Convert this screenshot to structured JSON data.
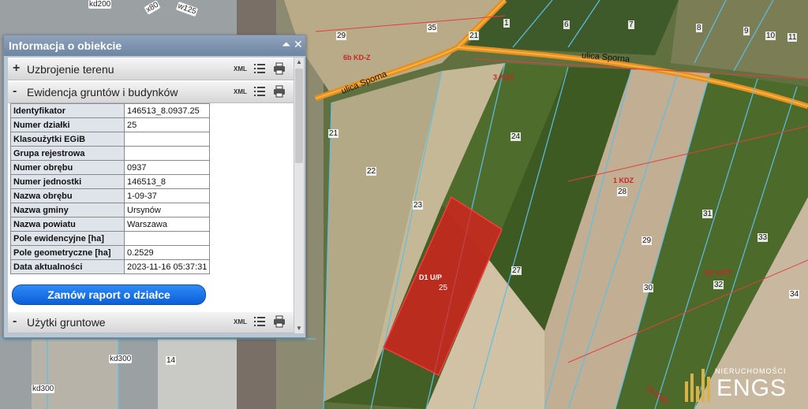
{
  "panel": {
    "title": "Informacja o obiekcie",
    "minimize_symbol": "⏶",
    "close_symbol": "✕",
    "sections": [
      {
        "sign": "+",
        "label": "Uzbrojenie terenu",
        "xml": "XML"
      },
      {
        "sign": "-",
        "label": "Ewidencja gruntów i budynków",
        "xml": "XML"
      },
      {
        "sign": "-",
        "label": "Użytki gruntowe",
        "xml": "XML"
      }
    ],
    "attributes": [
      {
        "key": "Identyfikator",
        "value": "146513_8.0937.25"
      },
      {
        "key": "Numer działki",
        "value": "25"
      },
      {
        "key": "Klasoużytki EGiB",
        "value": ""
      },
      {
        "key": "Grupa rejestrowa",
        "value": ""
      },
      {
        "key": "Numer obrębu",
        "value": "0937"
      },
      {
        "key": "Numer jednostki",
        "value": "146513_8"
      },
      {
        "key": "Nazwa obrębu",
        "value": "1-09-37"
      },
      {
        "key": "Nazwa gminy",
        "value": "Ursynów"
      },
      {
        "key": "Nazwa powiatu",
        "value": "Warszawa"
      },
      {
        "key": "Pole ewidencyjne [ha]",
        "value": ""
      },
      {
        "key": "Pole geometryczne [ha]",
        "value": "0.2529"
      },
      {
        "key": "Data aktualności",
        "value": "2023-11-16 05:37:31"
      }
    ],
    "report_button": "Zamów raport o działce"
  },
  "map": {
    "parcel_numbers": [
      "29",
      "35",
      "21",
      "1",
      "6",
      "7",
      "8",
      "9",
      "10",
      "11",
      "22",
      "21",
      "23",
      "24",
      "25",
      "26",
      "27",
      "28",
      "29",
      "30",
      "31",
      "32",
      "33",
      "34",
      "14"
    ],
    "zone_labels": [
      "6b KD-Z",
      "3 KDZ",
      "1 KDZ",
      "D1 U/P",
      "D2 U/ZP",
      "23 KDD"
    ],
    "road_labels": [
      "ulica Sporna",
      "ulica Sporna"
    ],
    "rail_labels": [
      "kd200",
      "kd300",
      "kd300",
      "w125",
      "x80"
    ],
    "selected_parcel": "25",
    "selected_color": "#e21b1b"
  },
  "logo": {
    "small": "NIERUCHOMOŚCI",
    "big": "ENGS"
  }
}
